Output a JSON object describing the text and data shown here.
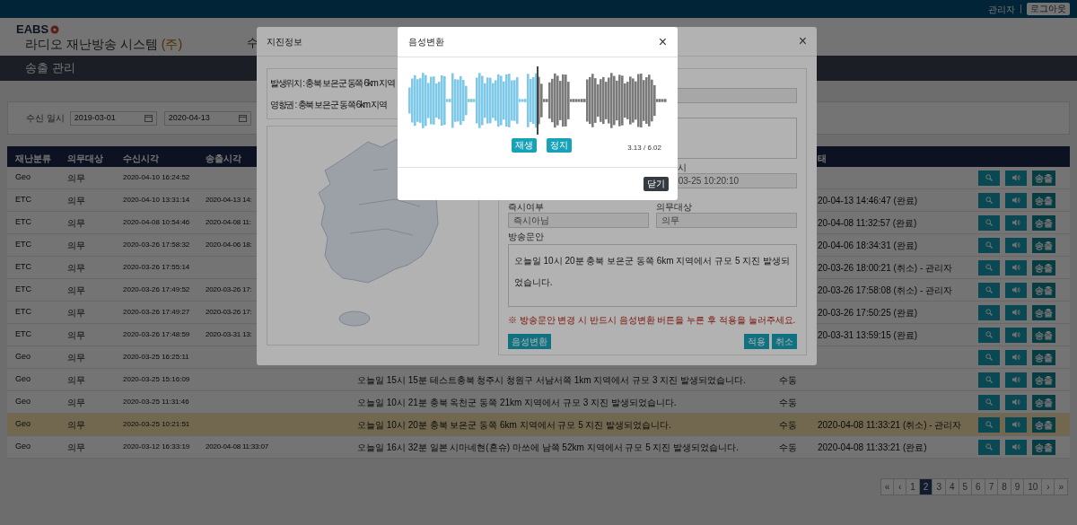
{
  "top_bar": {
    "user": "관리자",
    "logout_button": "로그아웃"
  },
  "header": {
    "logo": "EABS",
    "title": "라디오 재난방송 시스템",
    "title_suffix": "(주)",
    "menu_item": "수"
  },
  "section_title": "송출 관리",
  "search": {
    "label": "수신 일시",
    "date_from": "2019-03-01",
    "date_to": "2020-04-13"
  },
  "table": {
    "columns": [
      "재난분류",
      "의무대상",
      "수신시각",
      "송출시각",
      "태"
    ],
    "rows": [
      {
        "category": "Geo",
        "duty": "의무",
        "received": "2020-04-10 16:24:52",
        "selected": false,
        "send_button": "송출"
      },
      {
        "category": "ETC",
        "duty": "의무",
        "received": "2020-04-10 13:31:14",
        "sent": "2020-04-13 14:",
        "status": "20-04-13 14:46:47 (완료)",
        "selected": false,
        "send_button": "송출"
      },
      {
        "category": "ETC",
        "duty": "의무",
        "received": "2020-04-08 10:54:46",
        "sent": "2020-04-08 11:",
        "status": "20-04-08 11:32:57 (완료)",
        "selected": false,
        "send_button": "송출"
      },
      {
        "category": "ETC",
        "duty": "의무",
        "received": "2020-03-26 17:58:32",
        "sent": "2020-04-06 18:",
        "status": "20-04-06 18:34:31 (완료)",
        "selected": false,
        "send_button": "송출"
      },
      {
        "category": "ETC",
        "duty": "의무",
        "received": "2020-03-26 17:55:14",
        "status": "20-03-26 18:00:21 (취소) - 관리자",
        "selected": false,
        "send_button": "송출"
      },
      {
        "category": "ETC",
        "duty": "의무",
        "received": "2020-03-26 17:49:52",
        "sent": "2020-03-26 17:",
        "status": "20-03-26 17:58:08 (취소) - 관리자",
        "selected": false,
        "send_button": "송출"
      },
      {
        "category": "ETC",
        "duty": "의무",
        "received": "2020-03-26 17:49:27",
        "sent": "2020-03-26 17:",
        "status": "20-03-26 17:50:25 (완료)",
        "selected": false,
        "send_button": "송출"
      },
      {
        "category": "ETC",
        "duty": "의무",
        "received": "2020-03-26 17:48:59",
        "sent": "2020-03-31 13:",
        "status": "20-03-31 13:59:15 (완료)",
        "selected": false,
        "send_button": "송출"
      },
      {
        "category": "Geo",
        "duty": "의무",
        "received": "2020-03-25 16:25:11",
        "selected": false,
        "send_button": "송출"
      },
      {
        "category": "Geo",
        "duty": "의무",
        "received": "2020-03-25 15:16:09",
        "message": "오늘일 15시 15분 테스트충북 청주시 청원구 서남서쪽 1km 지역에서 규모 3 지진 발생되었습니다.",
        "mode": "수동",
        "selected": false,
        "send_button": "송출"
      },
      {
        "category": "Geo",
        "duty": "의무",
        "received": "2020-03-25 11:31:46",
        "message": "오늘일 10시 21분 충북 옥천군 동쪽 21km 지역에서 규모 3 지진 발생되었습니다.",
        "mode": "수동",
        "selected": false,
        "send_button": "송출"
      },
      {
        "category": "Geo",
        "duty": "의무",
        "received": "2020-03-25 10:21:51",
        "message": "오늘일 10시 20분 충북 보은군 동쪽 6km 지역에서 규모 5 지진 발생되었습니다.",
        "mode": "수동",
        "status": "2020-04-08 11:33:21 (취소) - 관리자",
        "selected": true,
        "send_button": "송출"
      },
      {
        "category": "Geo",
        "duty": "의무",
        "received": "2020-03-12 16:33:19",
        "sent": "2020-04-08 11:33:07",
        "message": "오늘일 16시 32분 일본 시마네현(혼슈) 마쓰에 남쪽 52km 지역에서 규모 5 지진 발생되었습니다.",
        "mode": "수동",
        "status": "2020-04-08 11:33:21 (완료)",
        "selected": false,
        "send_button": "송출"
      }
    ]
  },
  "pagination": [
    {
      "label": "«",
      "selected": false
    },
    {
      "label": "‹",
      "selected": false
    },
    {
      "label": "1",
      "selected": false
    },
    {
      "label": "2",
      "selected": true
    },
    {
      "label": "3",
      "selected": false
    },
    {
      "label": "4",
      "selected": false
    },
    {
      "label": "5",
      "selected": false
    },
    {
      "label": "6",
      "selected": false
    },
    {
      "label": "7",
      "selected": false
    },
    {
      "label": "8",
      "selected": false
    },
    {
      "label": "9",
      "selected": false
    },
    {
      "label": "10",
      "selected": false
    },
    {
      "label": "›",
      "selected": false
    },
    {
      "label": "»",
      "selected": false
    }
  ],
  "quake_modal": {
    "title": "지진정보",
    "close": "×",
    "location": "발생위치 : 충북 보은군 동쪽 6km 지역",
    "impact_area": "영향권 : 충북 보은군 동쪽 6km 지역",
    "time_label": "시",
    "time_value": "03-25 10:20:10",
    "immediate_label": "즉시여부",
    "immediate_value": "즉시아님",
    "duty_label": "의무대상",
    "duty_value": "의무",
    "message_label": "방송문안",
    "message": "오늘일 10시 20분 충북 보은군 동쪽 6km 지역에서 규모 5 지진 발생되었습니다.",
    "warning": "※ 방송문안 변경 시 반드시 음성변환 버튼을 누른 후 적용을 눌러주세요.",
    "convert_button": "음성변환",
    "apply_button": "적용",
    "cancel_button": "취소"
  },
  "audio_modal": {
    "title": "음성변환",
    "close": "×",
    "playback": {
      "level": 0.5
    },
    "play_button": "재생",
    "stop_button": "정지",
    "time": "3.13 / 6.02",
    "close_button": "닫기"
  }
}
